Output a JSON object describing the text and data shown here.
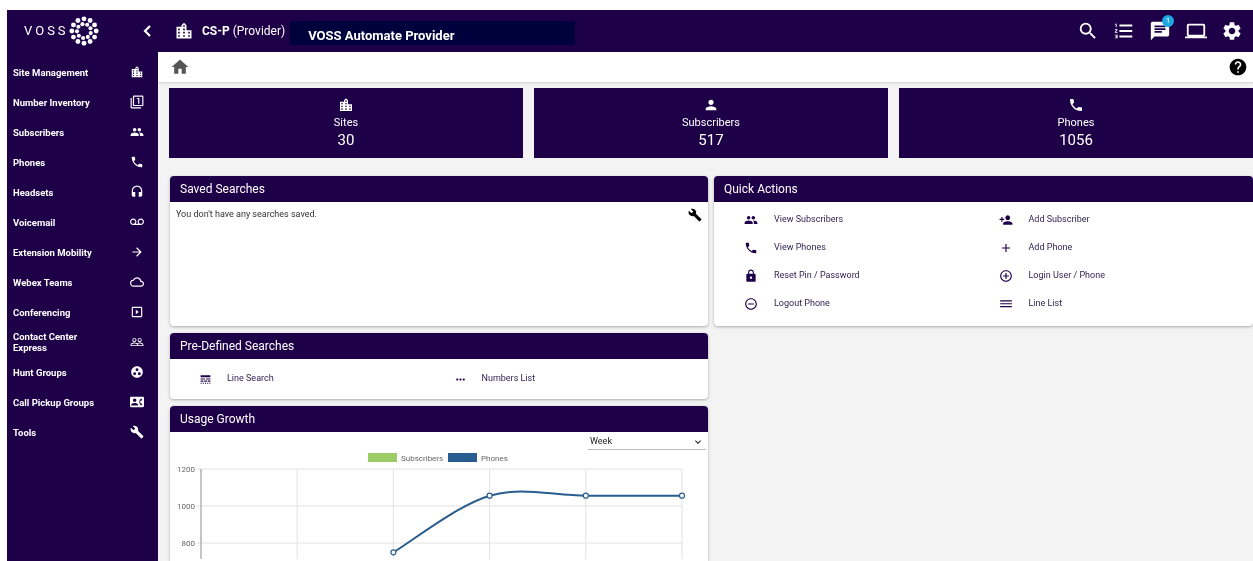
{
  "header": {
    "logo_text": "VOSS",
    "hierarchy": "**CS-P** (Provider)",
    "title": "VOSS Automate Provider",
    "notifications_badge": "1"
  },
  "sidebar": {
    "items": [
      {
        "label": "Site Management"
      },
      {
        "label": "Number Inventory"
      },
      {
        "label": "Subscribers"
      },
      {
        "label": "Phones"
      },
      {
        "label": "Headsets"
      },
      {
        "label": "Voicemail"
      },
      {
        "label": "Extension Mobility"
      },
      {
        "label": "Webex Teams"
      },
      {
        "label": "Conferencing"
      },
      {
        "label": "Contact Center Express"
      },
      {
        "label": "Hunt Groups"
      },
      {
        "label": "Call Pickup Groups"
      },
      {
        "label": "Tools"
      }
    ]
  },
  "stats": [
    {
      "label": "Sites",
      "value": "30"
    },
    {
      "label": "Subscribers",
      "value": "517"
    },
    {
      "label": "Phones",
      "value": "1056"
    }
  ],
  "saved_searches": {
    "title": "Saved Searches",
    "message": "You don't have any searches saved."
  },
  "quick_actions": {
    "title": "Quick Actions",
    "items": [
      {
        "label": "View Subscribers"
      },
      {
        "label": "Add Subscriber"
      },
      {
        "label": "View Phones"
      },
      {
        "label": "Add Phone"
      },
      {
        "label": "Reset Pin / Password"
      },
      {
        "label": "Login User / Phone"
      },
      {
        "label": "Logout Phone"
      },
      {
        "label": "Line List"
      }
    ]
  },
  "predefined_searches": {
    "title": "Pre-Defined Searches",
    "items": [
      {
        "label": "Line Search"
      },
      {
        "label": "Numbers List"
      }
    ]
  },
  "usage_growth": {
    "title": "Usage Growth",
    "period": "Week",
    "chart_data": {
      "type": "line",
      "grid": true,
      "ylim": [
        714,
        1200
      ],
      "yticks": [
        800,
        1000,
        1200
      ],
      "series": [
        {
          "name": "Subscribers",
          "color": "#9ccc65",
          "values": [
            null,
            null,
            null,
            null,
            null,
            null
          ]
        },
        {
          "name": "Phones",
          "color": "#2a5d8f",
          "marker": true,
          "values": [
            null,
            null,
            750,
            1056,
            1056,
            1056
          ]
        }
      ]
    }
  }
}
